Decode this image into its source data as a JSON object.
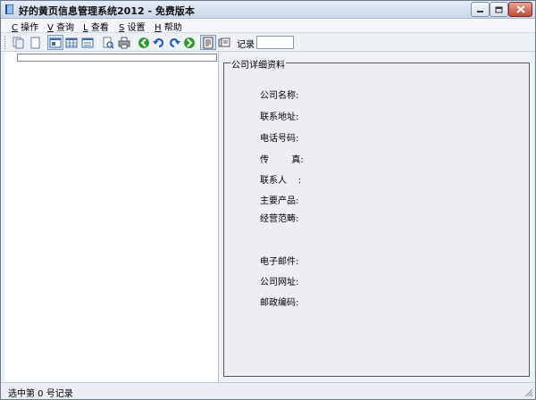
{
  "window": {
    "title": "好的黄页信息管理系统2012 - 免费版本"
  },
  "menu": [
    {
      "accel": "C",
      "label": " 操作"
    },
    {
      "accel": "V",
      "label": " 查询"
    },
    {
      "accel": "L",
      "label": " 查看"
    },
    {
      "accel": "S",
      "label": " 设置"
    },
    {
      "accel": "H",
      "label": " 帮助"
    }
  ],
  "toolbar": {
    "record_label": "记录",
    "record_value": ""
  },
  "groupbox": {
    "title": "公司详细资料",
    "fields": [
      {
        "label": "公司名称:"
      },
      {
        "label": "联系地址:"
      },
      {
        "label": "电话号码:"
      },
      {
        "label": "传        真:"
      },
      {
        "label": "联系人    :"
      },
      {
        "label": "主要产品:"
      },
      {
        "label": "经营范畴:"
      },
      {
        "label": "电子邮件:"
      },
      {
        "label": "公司网址:"
      },
      {
        "label": "邮政编码:"
      }
    ]
  },
  "status": {
    "text": "选中第 0 号记录"
  },
  "colors": {
    "accent": "#4a7fc0",
    "go_green": "#2f9a2f",
    "close_red": "#c4493a"
  }
}
